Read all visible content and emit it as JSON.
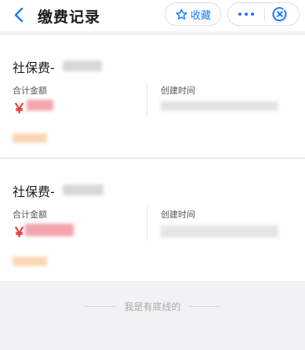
{
  "header": {
    "back_icon": "chevron-left-icon",
    "title": "缴费记录",
    "collect_label": "收藏",
    "collect_icon": "star-icon",
    "more_icon": "more-dots-icon",
    "close_icon": "close-circle-icon",
    "accent_color": "#1677ff"
  },
  "records": [
    {
      "title": "社保费-",
      "amount_label": "合计金额",
      "currency": "￥",
      "time_label": "创建时间"
    },
    {
      "title": "社保费-",
      "amount_label": "合计金额",
      "currency": "￥",
      "time_label": "创建时间"
    }
  ],
  "footer": {
    "text": "我是有底线的"
  },
  "colors": {
    "amount": "#ee3333",
    "background": "#f2f2f4"
  }
}
